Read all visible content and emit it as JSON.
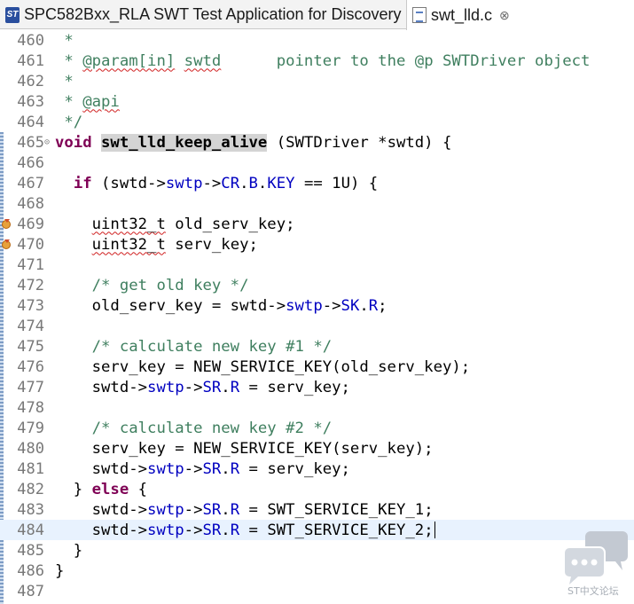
{
  "tabs": [
    {
      "label": "SPC582Bxx_RLA SWT Test Application for Discovery",
      "icon": "st-logo-icon",
      "active": false
    },
    {
      "label": "swt_lld.c",
      "icon": "c-file-icon",
      "active": true,
      "close": "⊗"
    }
  ],
  "editor": {
    "lines": [
      {
        "n": "460"
      },
      {
        "n": "461"
      },
      {
        "n": "462"
      },
      {
        "n": "463"
      },
      {
        "n": "464"
      },
      {
        "n": "465",
        "fold": "⊝"
      },
      {
        "n": "466"
      },
      {
        "n": "467"
      },
      {
        "n": "468"
      },
      {
        "n": "469",
        "marker": "warning"
      },
      {
        "n": "470",
        "marker": "warning"
      },
      {
        "n": "471"
      },
      {
        "n": "472"
      },
      {
        "n": "473"
      },
      {
        "n": "474"
      },
      {
        "n": "475"
      },
      {
        "n": "476"
      },
      {
        "n": "477"
      },
      {
        "n": "478"
      },
      {
        "n": "479"
      },
      {
        "n": "480"
      },
      {
        "n": "481"
      },
      {
        "n": "482"
      },
      {
        "n": "483"
      },
      {
        "n": "484",
        "current": true
      },
      {
        "n": "485"
      },
      {
        "n": "486"
      },
      {
        "n": "487"
      }
    ],
    "text": {
      "l460": " *",
      "l461_a": " * ",
      "l461_tag": "@param[in]",
      "l461_sp": " ",
      "l461_b": "swtd",
      "l461_c": "      pointer to the @p SWTDriver object",
      "l462": " *",
      "l463_a": " * ",
      "l463_b": "@api",
      "l464": " */",
      "l465_kw": "void",
      "l465_sp": " ",
      "l465_fn": "swt_lld_keep_alive",
      "l465_rest": " (SWTDriver *swtd) {",
      "l467_ind": "  ",
      "l467_kw": "if",
      "l467_a": " (swtd->",
      "l467_m1": "swtp",
      "l467_b": "->",
      "l467_m2": "CR",
      "l467_c": ".",
      "l467_m3": "B",
      "l467_d": ".",
      "l467_m4": "KEY",
      "l467_e": " == 1U) {",
      "l469_ind": "    ",
      "l469_t": "uint32_t",
      "l469_rest": " old_serv_key;",
      "l470_ind": "    ",
      "l470_t": "uint32_t",
      "l470_rest": " serv_key;",
      "l472": "    /* get old key */",
      "l473_a": "    old_serv_key = swtd->",
      "l473_m1": "swtp",
      "l473_b": "->",
      "l473_m2": "SK",
      "l473_c": ".",
      "l473_m3": "R",
      "l473_d": ";",
      "l475": "    /* calculate new key #1 */",
      "l476": "    serv_key = NEW_SERVICE_KEY(old_serv_key);",
      "l477_a": "    swtd->",
      "l477_m1": "swtp",
      "l477_b": "->",
      "l477_m2": "SR",
      "l477_c": ".",
      "l477_m3": "R",
      "l477_d": " = serv_key;",
      "l479": "    /* calculate new key #2 */",
      "l480": "    serv_key = NEW_SERVICE_KEY(serv_key);",
      "l481_a": "    swtd->",
      "l481_m1": "swtp",
      "l481_b": "->",
      "l481_m2": "SR",
      "l481_c": ".",
      "l481_m3": "R",
      "l481_d": " = serv_key;",
      "l482_a": "  } ",
      "l482_kw": "else",
      "l482_b": " {",
      "l483_a": "    swtd->",
      "l483_m1": "swtp",
      "l483_b": "->",
      "l483_m2": "SR",
      "l483_c": ".",
      "l483_m3": "R",
      "l483_d": " = SWT_SERVICE_KEY_1;",
      "l484_a": "    swtd->",
      "l484_m1": "swtp",
      "l484_b": "->",
      "l484_m2": "SR",
      "l484_c": ".",
      "l484_m3": "R",
      "l484_d": " = SWT_SERVICE_KEY_2;",
      "l485": "  }",
      "l486": "}"
    }
  },
  "watermark": {
    "text": "ST中文论坛",
    "icon": "chat-bubbles-icon"
  },
  "colors": {
    "comment": "#3f7f5f",
    "keyword": "#7f0055",
    "field": "#0000c0",
    "current_line": "#e8f2fe",
    "highlight": "#d4d4d4"
  }
}
